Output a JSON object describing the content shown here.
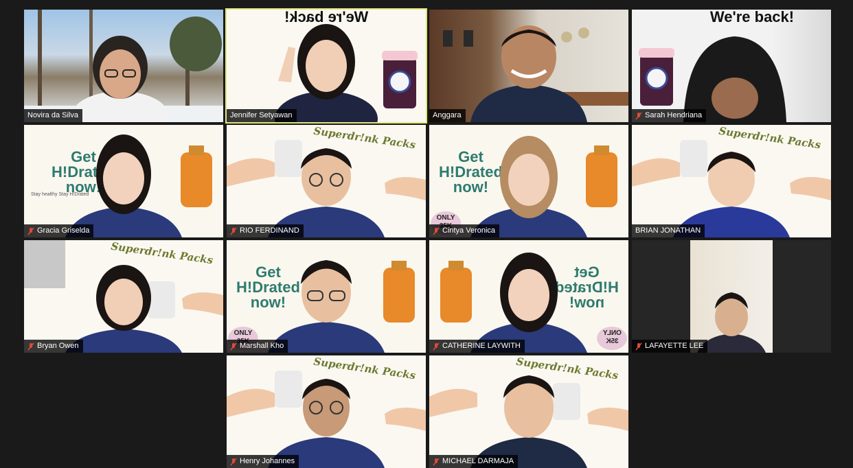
{
  "banners": {
    "back_mirrored": "We're back!",
    "back": "We're back!"
  },
  "promo": {
    "get_line1": "Get",
    "get_line2": "H!Drated",
    "get_line3": "now!",
    "tagline": "Stay healthy Stay H!Drated",
    "packs": "Superdr!nk Packs",
    "only": "ONLY",
    "price": "35K"
  },
  "participants": [
    {
      "name": "Novira da Silva",
      "muted": false
    },
    {
      "name": "Jennifer Setyawan",
      "muted": false,
      "active": true
    },
    {
      "name": "Anggara",
      "muted": false
    },
    {
      "name": "Sarah Hendriana",
      "muted": true
    },
    {
      "name": "Gracia Griselda",
      "muted": true
    },
    {
      "name": "RIO FERDINAND",
      "muted": true
    },
    {
      "name": "Cintya Veronica",
      "muted": true
    },
    {
      "name": "BRIAN JONATHAN",
      "muted": false
    },
    {
      "name": "Bryan Owen",
      "muted": true
    },
    {
      "name": "Marshall Kho",
      "muted": true
    },
    {
      "name": "CATHERINE LAYWITH",
      "muted": true
    },
    {
      "name": "LAFAYETTE LEE",
      "muted": true
    },
    {
      "name": "Henry Johannes",
      "muted": true
    },
    {
      "name": "MICHAEL DARMAJA",
      "muted": true
    }
  ],
  "colors": {
    "background": "#1a1a1a",
    "active_border": "#e3e77a",
    "mute_icon": "#e04a3a"
  }
}
